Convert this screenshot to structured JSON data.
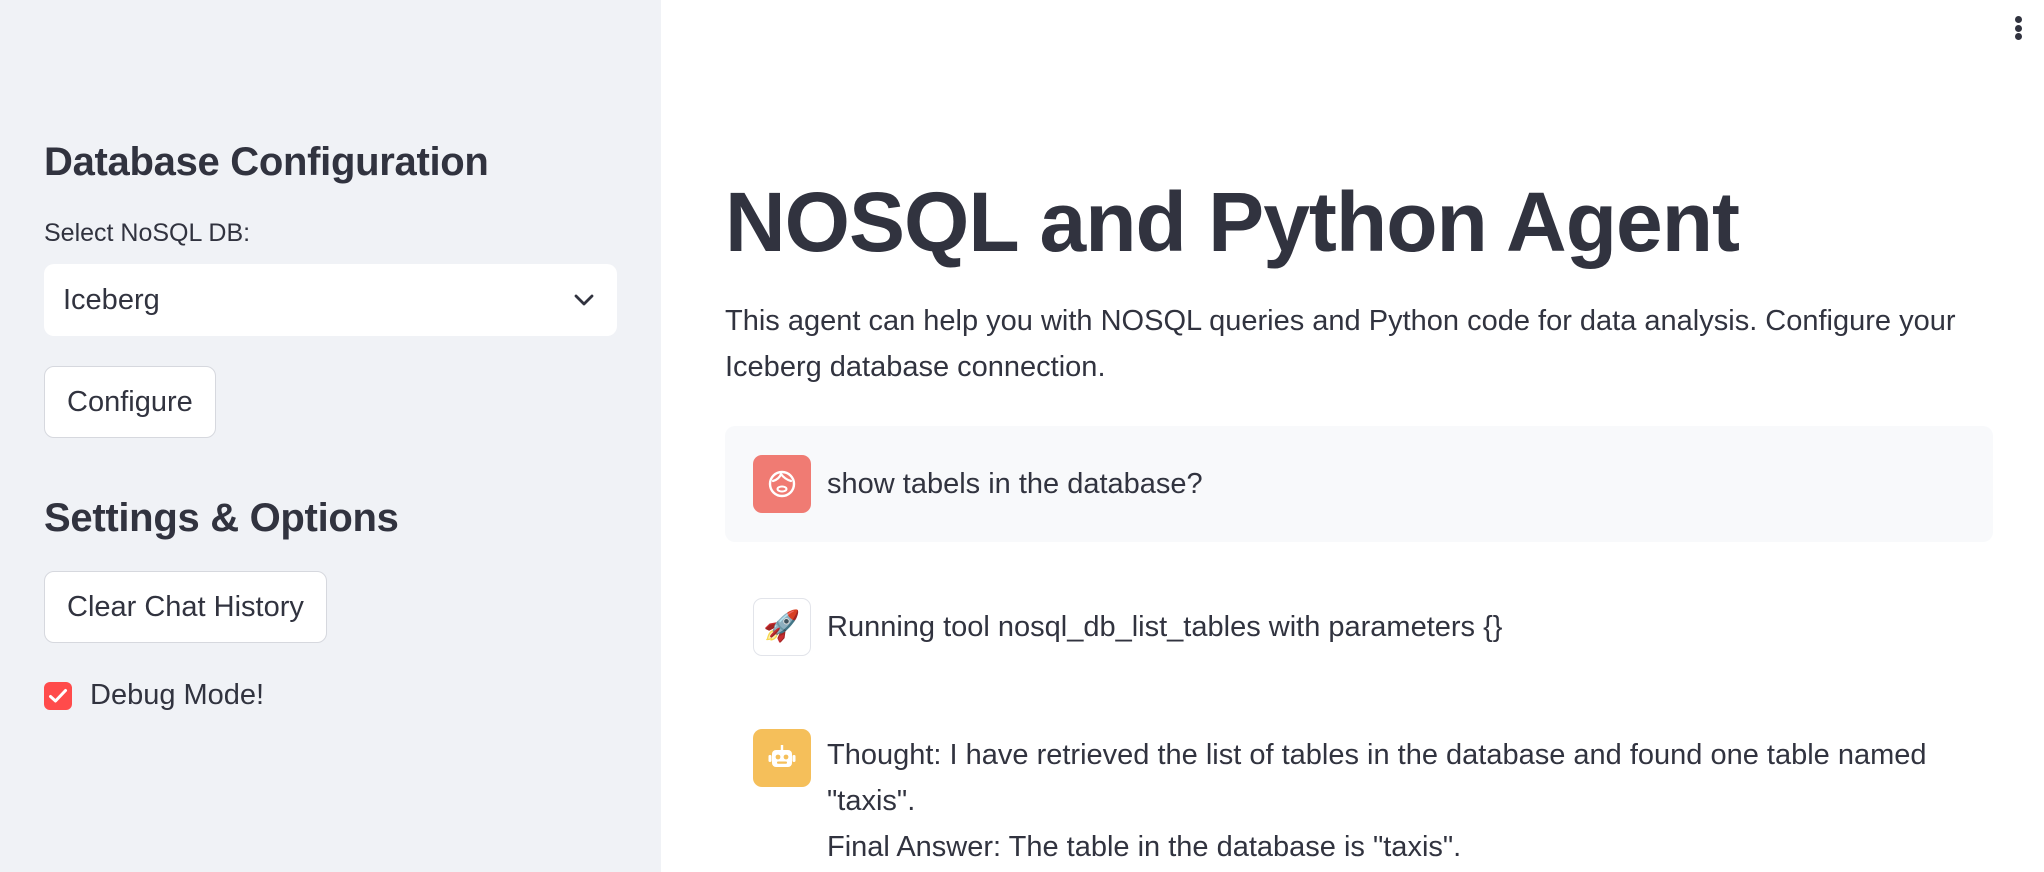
{
  "sidebar": {
    "db_heading": "Database Configuration",
    "select_label": "Select NoSQL DB:",
    "select_value": "Iceberg",
    "configure_label": "Configure",
    "settings_heading": "Settings & Options",
    "clear_label": "Clear Chat History",
    "debug_label": "Debug Mode!",
    "debug_checked": true
  },
  "main": {
    "title": "NOSQL and Python Agent",
    "intro": "This agent can help you with NOSQL queries and Python code for data analysis. Configure your Iceberg database connection."
  },
  "chat": {
    "messages": [
      {
        "role": "user",
        "avatar_icon": "user-face-icon",
        "text": "show tabels in the database?"
      },
      {
        "role": "tool",
        "avatar_icon": "rocket-icon",
        "text": "Running tool nosql_db_list_tables with parameters {}"
      },
      {
        "role": "assistant",
        "avatar_icon": "robot-icon",
        "lines": [
          "Thought: I have retrieved the list of tables in the database and found one table named \"taxis\".",
          "Final Answer: The table in the database is \"taxis\"."
        ]
      }
    ]
  },
  "colors": {
    "sidebar_bg": "#f0f2f6",
    "accent": "#ff4b4b",
    "user_avatar": "#f07b73",
    "bot_avatar": "#f5bf5a",
    "text": "#31333f"
  }
}
